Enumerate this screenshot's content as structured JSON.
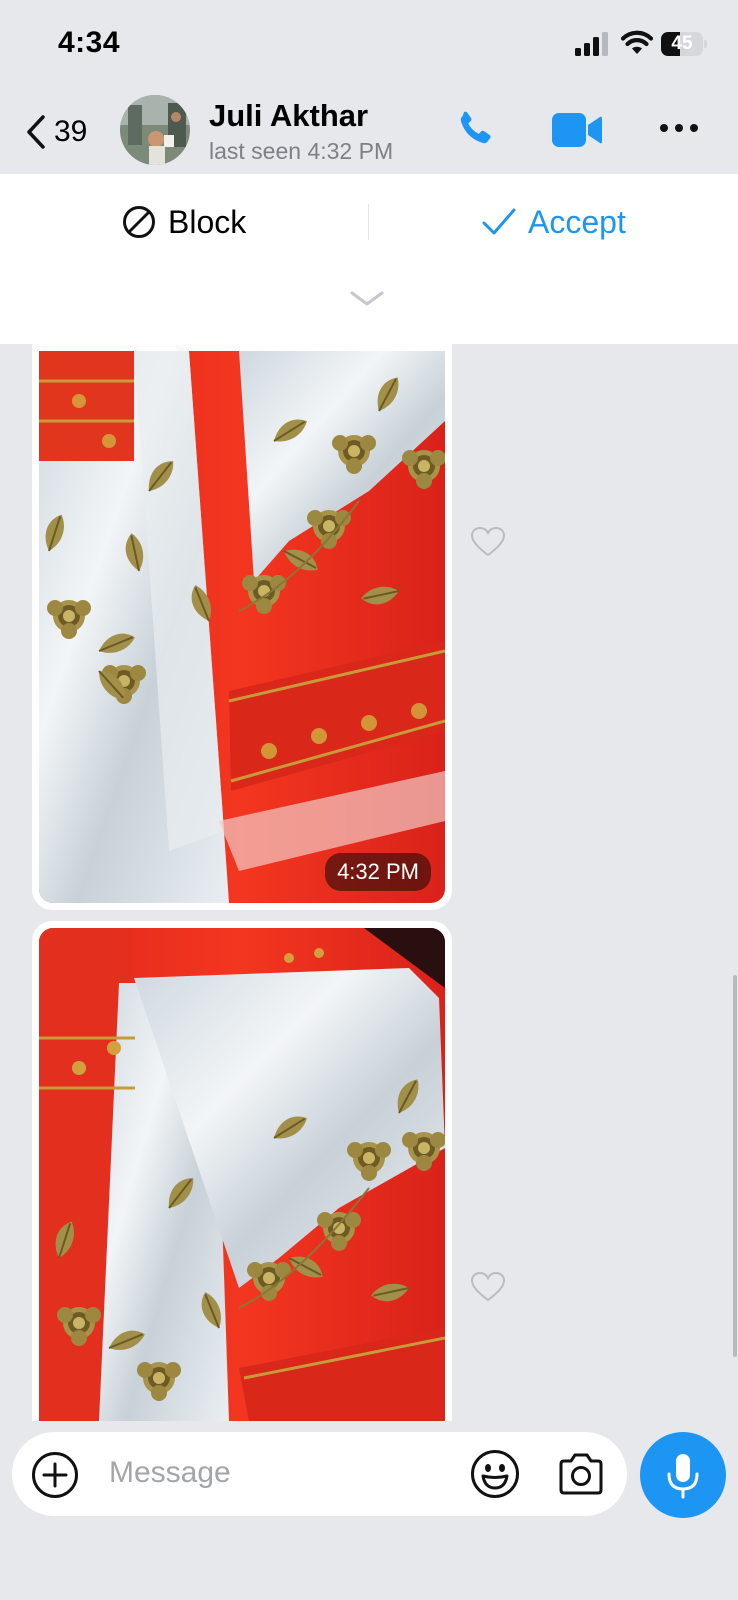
{
  "status_bar": {
    "time": "4:34",
    "battery_level": "45",
    "battery_fraction": 0.45
  },
  "header": {
    "back_count": "39",
    "contact_name": "Juli Akthar",
    "last_seen": "last seen 4:32 PM",
    "icons": [
      "chevron-left-icon",
      "phone-icon",
      "video-camera-icon",
      "more-icon"
    ]
  },
  "request": {
    "block_label": "Block",
    "accept_label": "Accept"
  },
  "messages": [
    {
      "type": "photo",
      "timestamp": "4:32 PM"
    },
    {
      "type": "photo"
    }
  ],
  "composer": {
    "placeholder": "Message"
  },
  "colors": {
    "accent": "#1c96f2",
    "background": "#e6e8eb",
    "fabric_red": "#e8271c",
    "fabric_white": "#dfe6ec",
    "embroidery_gold": "#a89448"
  }
}
